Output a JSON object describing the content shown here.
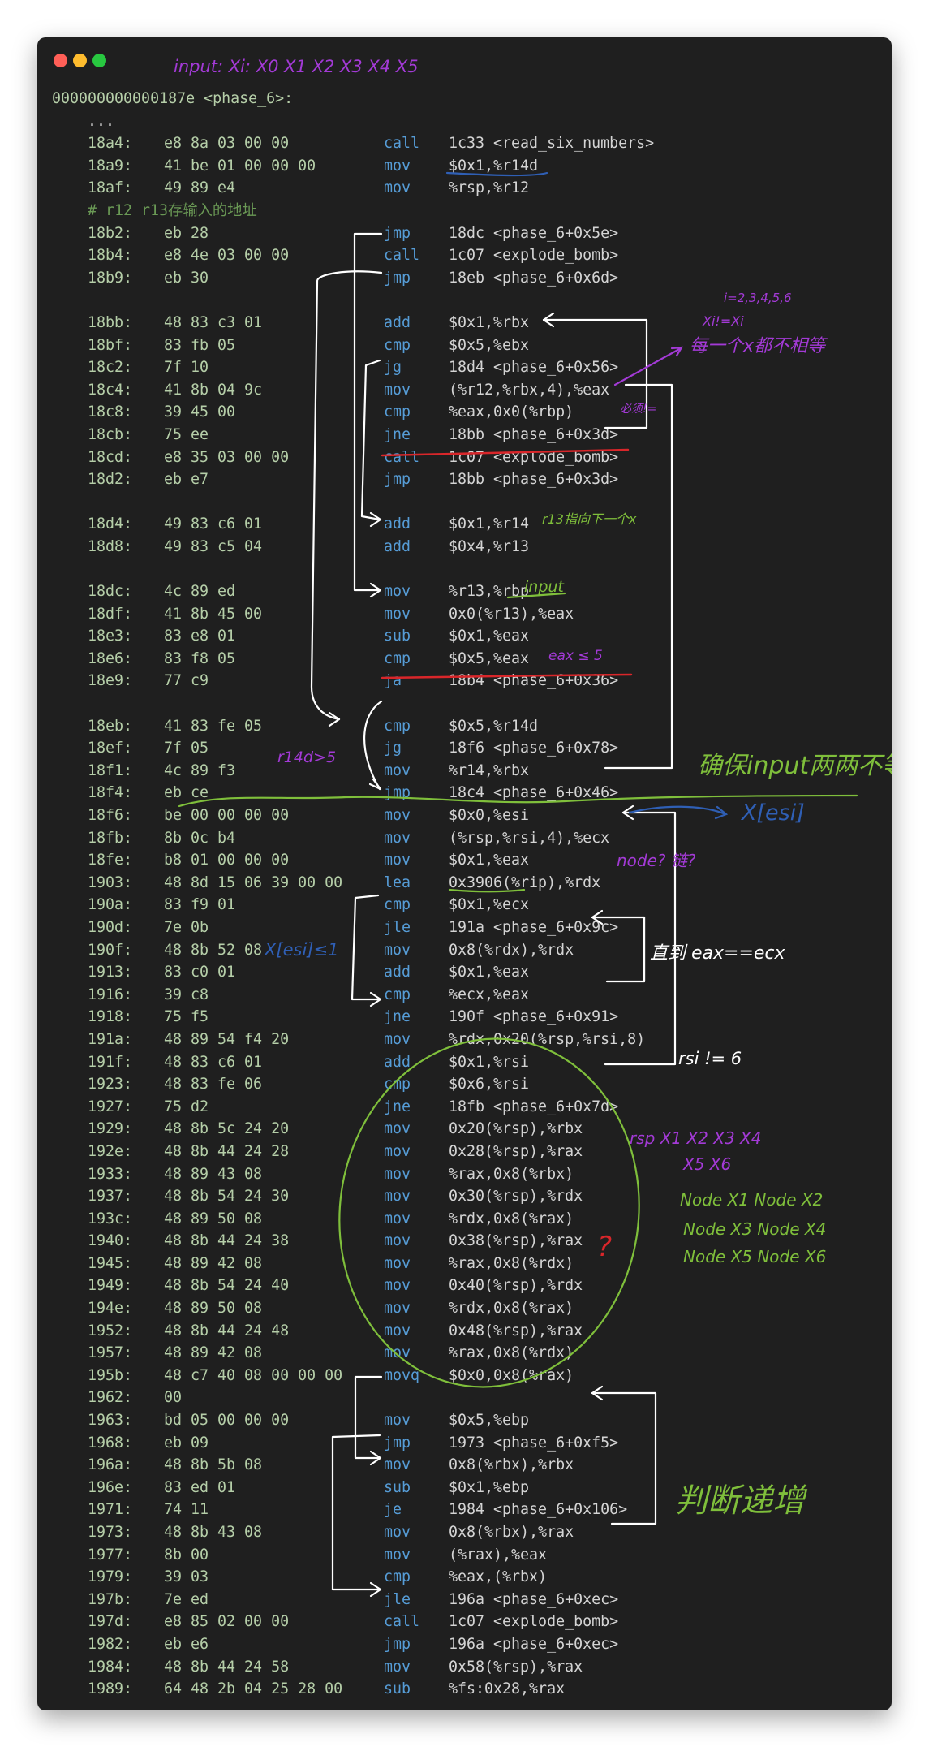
{
  "header": {
    "symbol": "000000000000187e <phase_6>:",
    "ellipsis": "..."
  },
  "listing": [
    {
      "addr": "18a4:",
      "bytes": "e8 8a 03 00 00",
      "mn": "call",
      "ops": "1c33 <read_six_numbers>"
    },
    {
      "addr": "18a9:",
      "bytes": "41 be 01 00 00 00",
      "mn": "mov",
      "ops": "$0x1,%r14d"
    },
    {
      "addr": "18af:",
      "bytes": "49 89 e4",
      "mn": "mov",
      "ops": "%rsp,%r12"
    },
    {
      "comment": "# r12 r13存输入的地址"
    },
    {
      "addr": "18b2:",
      "bytes": "eb 28",
      "mn": "jmp",
      "ops": "18dc <phase_6+0x5e>"
    },
    {
      "addr": "18b4:",
      "bytes": "e8 4e 03 00 00",
      "mn": "call",
      "ops": "1c07 <explode_bomb>"
    },
    {
      "addr": "18b9:",
      "bytes": "eb 30",
      "mn": "jmp",
      "ops": "18eb <phase_6+0x6d>"
    },
    {
      "blank": true
    },
    {
      "addr": "18bb:",
      "bytes": "48 83 c3 01",
      "mn": "add",
      "ops": "$0x1,%rbx"
    },
    {
      "addr": "18bf:",
      "bytes": "83 fb 05",
      "mn": "cmp",
      "ops": "$0x5,%ebx"
    },
    {
      "addr": "18c2:",
      "bytes": "7f 10",
      "mn": "jg",
      "ops": "18d4 <phase_6+0x56>"
    },
    {
      "addr": "18c4:",
      "bytes": "41 8b 04 9c",
      "mn": "mov",
      "ops": "(%r12,%rbx,4),%eax"
    },
    {
      "addr": "18c8:",
      "bytes": "39 45 00",
      "mn": "cmp",
      "ops": "%eax,0x0(%rbp)"
    },
    {
      "addr": "18cb:",
      "bytes": "75 ee",
      "mn": "jne",
      "ops": "18bb <phase_6+0x3d>"
    },
    {
      "addr": "18cd:",
      "bytes": "e8 35 03 00 00",
      "mn": "call",
      "ops": "1c07 <explode_bomb>"
    },
    {
      "addr": "18d2:",
      "bytes": "eb e7",
      "mn": "jmp",
      "ops": "18bb <phase_6+0x3d>"
    },
    {
      "blank": true
    },
    {
      "addr": "18d4:",
      "bytes": "49 83 c6 01",
      "mn": "add",
      "ops": "$0x1,%r14"
    },
    {
      "addr": "18d8:",
      "bytes": "49 83 c5 04",
      "mn": "add",
      "ops": "$0x4,%r13"
    },
    {
      "blank": true
    },
    {
      "addr": "18dc:",
      "bytes": "4c 89 ed",
      "mn": "mov",
      "ops": "%r13,%rbp"
    },
    {
      "addr": "18df:",
      "bytes": "41 8b 45 00",
      "mn": "mov",
      "ops": "0x0(%r13),%eax"
    },
    {
      "addr": "18e3:",
      "bytes": "83 e8 01",
      "mn": "sub",
      "ops": "$0x1,%eax"
    },
    {
      "addr": "18e6:",
      "bytes": "83 f8 05",
      "mn": "cmp",
      "ops": "$0x5,%eax"
    },
    {
      "addr": "18e9:",
      "bytes": "77 c9",
      "mn": "ja",
      "ops": "18b4 <phase_6+0x36>"
    },
    {
      "blank": true
    },
    {
      "addr": "18eb:",
      "bytes": "41 83 fe 05",
      "mn": "cmp",
      "ops": "$0x5,%r14d"
    },
    {
      "addr": "18ef:",
      "bytes": "7f 05",
      "mn": "jg",
      "ops": "18f6 <phase_6+0x78>"
    },
    {
      "addr": "18f1:",
      "bytes": "4c 89 f3",
      "mn": "mov",
      "ops": "%r14,%rbx"
    },
    {
      "addr": "18f4:",
      "bytes": "eb ce",
      "mn": "jmp",
      "ops": "18c4 <phase_6+0x46>"
    },
    {
      "addr": "18f6:",
      "bytes": "be 00 00 00 00",
      "mn": "mov",
      "ops": "$0x0,%esi"
    },
    {
      "addr": "18fb:",
      "bytes": "8b 0c b4",
      "mn": "mov",
      "ops": "(%rsp,%rsi,4),%ecx"
    },
    {
      "addr": "18fe:",
      "bytes": "b8 01 00 00 00",
      "mn": "mov",
      "ops": "$0x1,%eax"
    },
    {
      "addr": "1903:",
      "bytes": "48 8d 15 06 39 00 00",
      "mn": "lea",
      "ops": "0x3906(%rip),%rdx"
    },
    {
      "addr": "190a:",
      "bytes": "83 f9 01",
      "mn": "cmp",
      "ops": "$0x1,%ecx"
    },
    {
      "addr": "190d:",
      "bytes": "7e 0b",
      "mn": "jle",
      "ops": "191a <phase_6+0x9c>"
    },
    {
      "addr": "190f:",
      "bytes": "48 8b 52 08",
      "mn": "mov",
      "ops": "0x8(%rdx),%rdx"
    },
    {
      "addr": "1913:",
      "bytes": "83 c0 01",
      "mn": "add",
      "ops": "$0x1,%eax"
    },
    {
      "addr": "1916:",
      "bytes": "39 c8",
      "mn": "cmp",
      "ops": "%ecx,%eax"
    },
    {
      "addr": "1918:",
      "bytes": "75 f5",
      "mn": "jne",
      "ops": "190f <phase_6+0x91>"
    },
    {
      "addr": "191a:",
      "bytes": "48 89 54 f4 20",
      "mn": "mov",
      "ops": "%rdx,0x20(%rsp,%rsi,8)"
    },
    {
      "addr": "191f:",
      "bytes": "48 83 c6 01",
      "mn": "add",
      "ops": "$0x1,%rsi"
    },
    {
      "addr": "1923:",
      "bytes": "48 83 fe 06",
      "mn": "cmp",
      "ops": "$0x6,%rsi"
    },
    {
      "addr": "1927:",
      "bytes": "75 d2",
      "mn": "jne",
      "ops": "18fb <phase_6+0x7d>"
    },
    {
      "addr": "1929:",
      "bytes": "48 8b 5c 24 20",
      "mn": "mov",
      "ops": "0x20(%rsp),%rbx"
    },
    {
      "addr": "192e:",
      "bytes": "48 8b 44 24 28",
      "mn": "mov",
      "ops": "0x28(%rsp),%rax"
    },
    {
      "addr": "1933:",
      "bytes": "48 89 43 08",
      "mn": "mov",
      "ops": "%rax,0x8(%rbx)"
    },
    {
      "addr": "1937:",
      "bytes": "48 8b 54 24 30",
      "mn": "mov",
      "ops": "0x30(%rsp),%rdx"
    },
    {
      "addr": "193c:",
      "bytes": "48 89 50 08",
      "mn": "mov",
      "ops": "%rdx,0x8(%rax)"
    },
    {
      "addr": "1940:",
      "bytes": "48 8b 44 24 38",
      "mn": "mov",
      "ops": "0x38(%rsp),%rax"
    },
    {
      "addr": "1945:",
      "bytes": "48 89 42 08",
      "mn": "mov",
      "ops": "%rax,0x8(%rdx)"
    },
    {
      "addr": "1949:",
      "bytes": "48 8b 54 24 40",
      "mn": "mov",
      "ops": "0x40(%rsp),%rdx"
    },
    {
      "addr": "194e:",
      "bytes": "48 89 50 08",
      "mn": "mov",
      "ops": "%rdx,0x8(%rax)"
    },
    {
      "addr": "1952:",
      "bytes": "48 8b 44 24 48",
      "mn": "mov",
      "ops": "0x48(%rsp),%rax"
    },
    {
      "addr": "1957:",
      "bytes": "48 89 42 08",
      "mn": "mov",
      "ops": "%rax,0x8(%rdx)"
    },
    {
      "addr": "195b:",
      "bytes": "48 c7 40 08 00 00 00",
      "mn": "movq",
      "ops": "$0x0,0x8(%rax)"
    },
    {
      "addr": "1962:",
      "bytes": "00",
      "mn": "",
      "ops": ""
    },
    {
      "addr": "1963:",
      "bytes": "bd 05 00 00 00",
      "mn": "mov",
      "ops": "$0x5,%ebp"
    },
    {
      "addr": "1968:",
      "bytes": "eb 09",
      "mn": "jmp",
      "ops": "1973 <phase_6+0xf5>"
    },
    {
      "addr": "196a:",
      "bytes": "48 8b 5b 08",
      "mn": "mov",
      "ops": "0x8(%rbx),%rbx"
    },
    {
      "addr": "196e:",
      "bytes": "83 ed 01",
      "mn": "sub",
      "ops": "$0x1,%ebp"
    },
    {
      "addr": "1971:",
      "bytes": "74 11",
      "mn": "je",
      "ops": "1984 <phase_6+0x106>"
    },
    {
      "addr": "1973:",
      "bytes": "48 8b 43 08",
      "mn": "mov",
      "ops": "0x8(%rbx),%rax"
    },
    {
      "addr": "1977:",
      "bytes": "8b 00",
      "mn": "mov",
      "ops": "(%rax),%eax"
    },
    {
      "addr": "1979:",
      "bytes": "39 03",
      "mn": "cmp",
      "ops": "%eax,(%rbx)"
    },
    {
      "addr": "197b:",
      "bytes": "7e ed",
      "mn": "jle",
      "ops": "196a <phase_6+0xec>"
    },
    {
      "addr": "197d:",
      "bytes": "e8 85 02 00 00",
      "mn": "call",
      "ops": "1c07 <explode_bomb>"
    },
    {
      "addr": "1982:",
      "bytes": "eb e6",
      "mn": "jmp",
      "ops": "196a <phase_6+0xec>"
    },
    {
      "addr": "1984:",
      "bytes": "48 8b 44 24 58",
      "mn": "mov",
      "ops": "0x58(%rsp),%rax"
    },
    {
      "addr": "1989:",
      "bytes": "64 48 2b 04 25 28 00",
      "mn": "sub",
      "ops": "%fs:0x28,%rax"
    }
  ],
  "annotations": {
    "input_header": "input: Xi: X0 X1 X2 X3 X4 X5",
    "i_range": "i=2,3,4,5,6",
    "xi_struck": "Xi!=Xi",
    "each_different": "每一个x都不相等",
    "must_ne": "必须!=",
    "r13_next": "r13指向下一个x",
    "input_word": "input",
    "eax_le5": "eax ≤ 5",
    "r14d_gt5": "r14d>5",
    "ensure_distinct": "确保input两两不等",
    "x_esi": "X[esi]",
    "node_question": "node? 链?",
    "until_eq": "直到 eax==ecx",
    "x_esi_le1": "X[esi]≤1",
    "rsi_ne6": "rsi != 6",
    "rsp_row1": "rsp  X1  X2  X3  X4",
    "rsp_row2": "X5  X6",
    "node_row1": "Node X1   Node X2",
    "node_row2": "Node X3   Node X4",
    "node_row3": "Node X5   Node X6",
    "question_mark": "?",
    "judge_increase": "判断递增"
  },
  "colors": {
    "background": "#1f1f1f",
    "address": "#b5cea8",
    "mnemonic": "#569cd6",
    "comment": "#6a9955",
    "ann_purple": "#a33ad6",
    "ann_green": "#7fbf3b",
    "ann_blue": "#2f5fb5",
    "ann_red": "#d9262a"
  }
}
